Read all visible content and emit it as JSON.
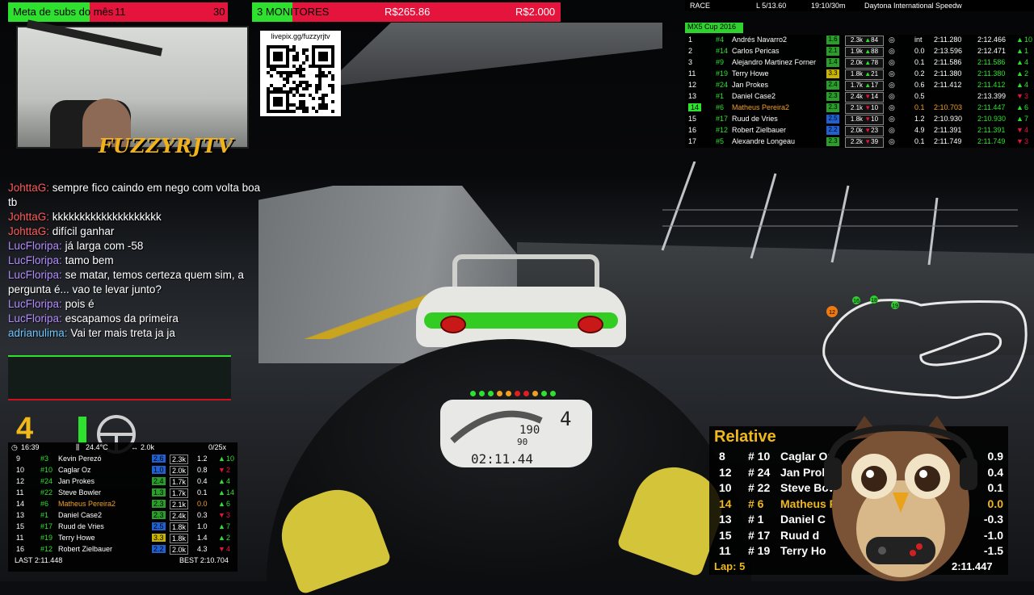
{
  "colors": {
    "accent_green": "#2fe12f",
    "accent_red": "#e4143c",
    "highlight_orange": "#f0a020",
    "relative_gold": "#f0b81a"
  },
  "top_bar": {
    "subs_goal": {
      "label": "Meta de subs do mês",
      "current": "11",
      "target": "30",
      "progress": 0.37
    },
    "monitors_goal": {
      "label": "3 MONITORES",
      "current": "R$265.86",
      "target": "R$2.000",
      "progress": 0.13
    }
  },
  "webcam": {
    "channel_name": "FUZZYRJTV"
  },
  "qr": {
    "url_label": "livepix.gg/fuzzyrjtv"
  },
  "chat": [
    {
      "user": "JohttaG:",
      "user_color": "#ff5a5a",
      "text": "sempre fico caindo em nego com volta boa tb"
    },
    {
      "user": "JohttaG:",
      "user_color": "#ff5a5a",
      "text": "kkkkkkkkkkkkkkkkkkkk"
    },
    {
      "user": "JohttaG:",
      "user_color": "#ff5a5a",
      "text": "difícil ganhar"
    },
    {
      "user": "LucFloripa:",
      "user_color": "#b58cff",
      "text": "já larga com -58"
    },
    {
      "user": "LucFloripa:",
      "user_color": "#b58cff",
      "text": "tamo bem"
    },
    {
      "user": "LucFloripa:",
      "user_color": "#b58cff",
      "text": "se matar, temos certeza quem sim, a pergunta é... vao te levar junto?"
    },
    {
      "user": "LucFloripa:",
      "user_color": "#b58cff",
      "text": "pois é"
    },
    {
      "user": "LucFloripa:",
      "user_color": "#b58cff",
      "text": "escapamos da primeira"
    },
    {
      "user": "adrianulima:",
      "user_color": "#6ec6ff",
      "text": "Vai ter mais treta ja ja"
    }
  ],
  "race_header": {
    "session": "RACE",
    "laps": "L 5/13.60",
    "time": "19:10/30m",
    "track": "Daytona International Speedw"
  },
  "standings": {
    "class_name": "MX5 Cup 2016",
    "rows": [
      {
        "pos": "1",
        "num": "#4",
        "name": "Andrés Navarro2",
        "lic": "1.6",
        "lic_color": "#2a9e2a",
        "ir": "2.3k",
        "chg": "84",
        "up": true,
        "gap": "int",
        "last": "2:11.280",
        "best": "2:12.466",
        "pchg": "10",
        "pup": true,
        "highlight": false,
        "best_green": false
      },
      {
        "pos": "2",
        "num": "#14",
        "name": "Carlos Pericas",
        "lic": "2.1",
        "lic_color": "#2a9e2a",
        "ir": "1.9k",
        "chg": "88",
        "up": true,
        "gap": "0.0",
        "last": "2:13.596",
        "best": "2:12.471",
        "pchg": "1",
        "pup": true,
        "highlight": false,
        "best_green": false
      },
      {
        "pos": "3",
        "num": "#9",
        "name": "Alejandro Martinez Forner",
        "lic": "1.4",
        "lic_color": "#2a9e2a",
        "ir": "2.0k",
        "chg": "78",
        "up": true,
        "gap": "0.1",
        "last": "2:11.586",
        "best": "2:11.586",
        "pchg": "4",
        "pup": true,
        "highlight": false,
        "best_green": true
      },
      {
        "pos": "11",
        "num": "#19",
        "name": "Terry Howe",
        "lic": "3.3",
        "lic_color": "#c9b400",
        "ir": "1.8k",
        "chg": "21",
        "up": true,
        "gap": "0.2",
        "last": "2:11.380",
        "best": "2:11.380",
        "pchg": "2",
        "pup": true,
        "highlight": false,
        "best_green": true
      },
      {
        "pos": "12",
        "num": "#24",
        "name": "Jan Prokes",
        "lic": "2.4",
        "lic_color": "#2a9e2a",
        "ir": "1.7k",
        "chg": "17",
        "up": true,
        "gap": "0.6",
        "last": "2:11.412",
        "best": "2:11.412",
        "pchg": "4",
        "pup": true,
        "highlight": false,
        "best_green": true
      },
      {
        "pos": "13",
        "num": "#1",
        "name": "Daniel Case2",
        "lic": "2.3",
        "lic_color": "#2a9e2a",
        "ir": "2.4k",
        "chg": "14",
        "up": false,
        "gap": "0.5",
        "last": "",
        "best": "2:13.399",
        "pchg": "3",
        "pup": false,
        "highlight": false,
        "best_green": false
      },
      {
        "pos": "14",
        "num": "#6",
        "name": "Matheus Pereira2",
        "lic": "2.3",
        "lic_color": "#2a9e2a",
        "ir": "2.1k",
        "chg": "10",
        "up": false,
        "gap": "0.1",
        "last": "2:10.703",
        "best": "2:11.447",
        "pchg": "6",
        "pup": true,
        "highlight": true,
        "best_green": true
      },
      {
        "pos": "15",
        "num": "#17",
        "name": "Ruud de Vries",
        "lic": "2.5",
        "lic_color": "#2060d0",
        "ir": "1.8k",
        "chg": "10",
        "up": false,
        "gap": "1.2",
        "last": "2:10.930",
        "best": "2:10.930",
        "pchg": "7",
        "pup": true,
        "highlight": false,
        "best_green": true
      },
      {
        "pos": "16",
        "num": "#12",
        "name": "Robert Zielbauer",
        "lic": "2.2",
        "lic_color": "#2060d0",
        "ir": "2.0k",
        "chg": "23",
        "up": false,
        "gap": "4.9",
        "last": "2:11.391",
        "best": "2:11.391",
        "pchg": "4",
        "pup": false,
        "highlight": false,
        "best_green": true
      },
      {
        "pos": "17",
        "num": "#5",
        "name": "Alexandre Longeau",
        "lic": "2.3",
        "lic_color": "#2a9e2a",
        "ir": "2.2k",
        "chg": "39",
        "up": false,
        "gap": "0.1",
        "last": "2:11.749",
        "best": "2:11.749",
        "pchg": "3",
        "pup": false,
        "highlight": false,
        "best_green": true
      }
    ]
  },
  "track_map": {
    "markers": [
      "12",
      "16",
      "18",
      "19"
    ]
  },
  "dashboard": {
    "speed": "190",
    "gear": "4",
    "rpm": "90",
    "lap_time": "02:11.44"
  },
  "bottom_left": {
    "gear": "4",
    "status": {
      "clock": "16:39",
      "temp": "24.4°C",
      "wind": "2.0k",
      "incidents": "0/25x"
    },
    "rows": [
      {
        "pos": "9",
        "num": "#3",
        "name": "Kevin Perezó",
        "lic": "2.6",
        "lic_color": "#2060d0",
        "ir": "2.3k",
        "gap": "1.2",
        "chg": "10",
        "up": true,
        "highlight": false
      },
      {
        "pos": "10",
        "num": "#10",
        "name": "Caglar Oz",
        "lic": "1.0",
        "lic_color": "#2060d0",
        "ir": "2.0k",
        "gap": "0.8",
        "chg": "2",
        "up": false,
        "highlight": false
      },
      {
        "pos": "12",
        "num": "#24",
        "name": "Jan Prokes",
        "lic": "2.4",
        "lic_color": "#2a9e2a",
        "ir": "1.7k",
        "gap": "0.4",
        "chg": "4",
        "up": true,
        "highlight": false
      },
      {
        "pos": "11",
        "num": "#22",
        "name": "Steve Bowler",
        "lic": "1.3",
        "lic_color": "#2a9e2a",
        "ir": "1.7k",
        "gap": "0.1",
        "chg": "14",
        "up": true,
        "highlight": false
      },
      {
        "pos": "14",
        "num": "#6",
        "name": "Matheus Pereira2",
        "lic": "2.3",
        "lic_color": "#2a9e2a",
        "ir": "2.1k",
        "gap": "0.0",
        "chg": "6",
        "up": true,
        "highlight": true
      },
      {
        "pos": "13",
        "num": "#1",
        "name": "Daniel Case2",
        "lic": "2.3",
        "lic_color": "#2a9e2a",
        "ir": "2.4k",
        "gap": "0.3",
        "chg": "3",
        "up": false,
        "highlight": false
      },
      {
        "pos": "15",
        "num": "#17",
        "name": "Ruud de Vries",
        "lic": "2.5",
        "lic_color": "#2060d0",
        "ir": "1.8k",
        "gap": "1.0",
        "chg": "7",
        "up": true,
        "highlight": false
      },
      {
        "pos": "11",
        "num": "#19",
        "name": "Terry Howe",
        "lic": "3.3",
        "lic_color": "#c9b400",
        "ir": "1.8k",
        "gap": "1.4",
        "chg": "2",
        "up": true,
        "highlight": false
      },
      {
        "pos": "16",
        "num": "#12",
        "name": "Robert Zielbauer",
        "lic": "2.2",
        "lic_color": "#2060d0",
        "ir": "2.0k",
        "gap": "4.3",
        "chg": "4",
        "up": false,
        "highlight": false
      }
    ],
    "last": "LAST 2:11.448",
    "best": "BEST 2:10.704"
  },
  "relative": {
    "title": "Relative",
    "rows": [
      {
        "pos": "8",
        "num": "# 10",
        "name": "Caglar Oz",
        "gap": "0.9",
        "highlight": false
      },
      {
        "pos": "12",
        "num": "# 24",
        "name": "Jan Prok",
        "gap": "0.4",
        "highlight": false
      },
      {
        "pos": "10",
        "num": "# 22",
        "name": "Steve Bow",
        "gap": "0.1",
        "highlight": false
      },
      {
        "pos": "14",
        "num": "# 6",
        "name": "Matheus P",
        "gap": "0.0",
        "highlight": true
      },
      {
        "pos": "13",
        "num": "# 1",
        "name": "Daniel C",
        "gap": "-0.3",
        "highlight": false
      },
      {
        "pos": "15",
        "num": "# 17",
        "name": "Ruud d",
        "gap": "-1.0",
        "highlight": false
      },
      {
        "pos": "11",
        "num": "# 19",
        "name": "Terry Ho",
        "gap": "-1.5",
        "highlight": false
      }
    ],
    "lap_label": "Lap:",
    "lap": "5",
    "lap_time": "2:11.447"
  }
}
